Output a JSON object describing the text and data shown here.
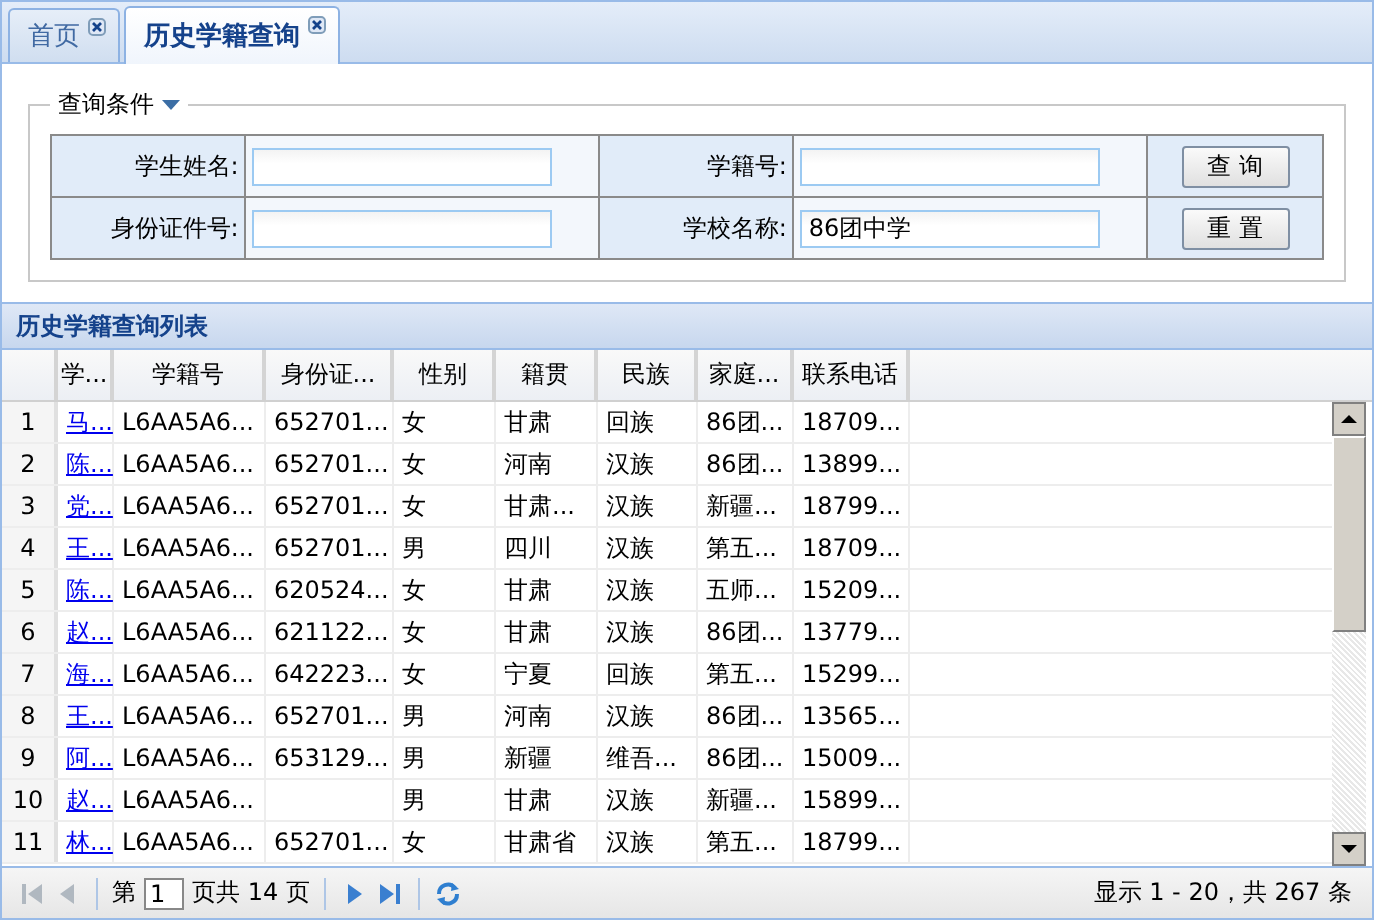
{
  "tabs": [
    {
      "label": "首页",
      "selected": false
    },
    {
      "label": "历史学籍查询",
      "selected": true
    }
  ],
  "query": {
    "legend": "查询条件",
    "fields": [
      {
        "label": "学生姓名:"
      },
      {
        "label": "学籍号:"
      },
      {
        "label": "身份证件号:"
      },
      {
        "label": "学校名称:",
        "value": "86团中学"
      }
    ],
    "buttons": [
      "查 询",
      "重 置"
    ]
  },
  "grid": {
    "title": "历史学籍查询列表",
    "columns": [
      "学...",
      "学籍号",
      "身份证...",
      "性别",
      "籍贯",
      "民族",
      "家庭...",
      "联系电话"
    ],
    "rows": [
      {
        "num": "1",
        "cells": [
          "马...",
          "L6AA5A6...",
          "652701...",
          "女",
          "甘肃",
          "回族",
          "86团...",
          "18709..."
        ]
      },
      {
        "num": "2",
        "cells": [
          "陈...",
          "L6AA5A6...",
          "652701...",
          "女",
          "河南",
          "汉族",
          "86团...",
          "13899..."
        ]
      },
      {
        "num": "3",
        "cells": [
          "党...",
          "L6AA5A6...",
          "652701...",
          "女",
          "甘肃...",
          "汉族",
          "新疆...",
          "18799..."
        ]
      },
      {
        "num": "4",
        "cells": [
          "王...",
          "L6AA5A6...",
          "652701...",
          "男",
          "四川",
          "汉族",
          "第五...",
          "18709..."
        ]
      },
      {
        "num": "5",
        "cells": [
          "陈...",
          "L6AA5A6...",
          "620524...",
          "女",
          "甘肃",
          "汉族",
          "五师...",
          "15209..."
        ]
      },
      {
        "num": "6",
        "cells": [
          "赵...",
          "L6AA5A6...",
          "621122...",
          "女",
          "甘肃",
          "汉族",
          "86团...",
          "13779..."
        ]
      },
      {
        "num": "7",
        "cells": [
          "海...",
          "L6AA5A6...",
          "642223...",
          "女",
          "宁夏",
          "回族",
          "第五...",
          "15299..."
        ]
      },
      {
        "num": "8",
        "cells": [
          "王...",
          "L6AA5A6...",
          "652701...",
          "男",
          "河南",
          "汉族",
          "86团...",
          "13565..."
        ]
      },
      {
        "num": "9",
        "cells": [
          "阿...",
          "L6AA5A6...",
          "653129...",
          "男",
          "新疆",
          "维吾...",
          "86团...",
          "15009..."
        ]
      },
      {
        "num": "10",
        "cells": [
          "赵...",
          "L6AA5A6...",
          null,
          "男",
          "甘肃",
          "汉族",
          "新疆...",
          "15899..."
        ]
      },
      {
        "num": "11",
        "cells": [
          "林...",
          "L6AA5A6...",
          "652701...",
          "女",
          "甘肃省",
          "汉族",
          "第五...",
          "18799..."
        ]
      }
    ]
  },
  "pager": {
    "before": "第",
    "page": "1",
    "after": "页共 14 页",
    "summary": "显示 1 - 20，共 267 条"
  }
}
